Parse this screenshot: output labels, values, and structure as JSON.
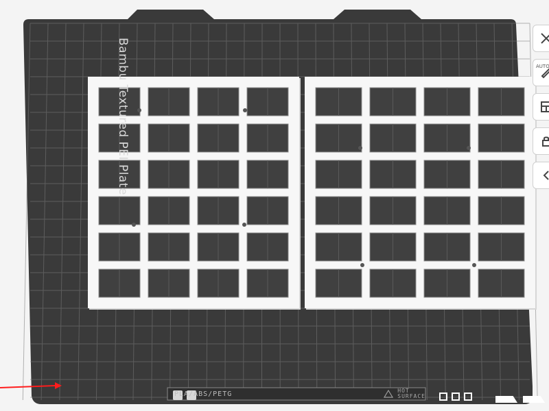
{
  "plate": {
    "label": "Bambu Textured PEI Plate",
    "material_types": "PLA/ABS/PETG",
    "hot_surface": {
      "line1": "HOT",
      "line2": "SURFACE"
    }
  },
  "toolbar": {
    "auto_label": "AUTO",
    "items": [
      {
        "name": "close-icon"
      },
      {
        "name": "auto-orient-icon"
      },
      {
        "name": "layout-icon"
      },
      {
        "name": "lock-icon"
      },
      {
        "name": "chevron-left-icon"
      }
    ]
  },
  "colors": {
    "background": "#f4f4f4",
    "plate": "#3a3a3a",
    "grid": "#7a7a7a",
    "object_fill": "#f7f7f7",
    "object_shadow": "#d6d6d6",
    "axis_red": "#ff1c1c"
  },
  "scene": {
    "object_count": 2,
    "grid_rows": 6,
    "grid_cols_per_object": 4
  }
}
